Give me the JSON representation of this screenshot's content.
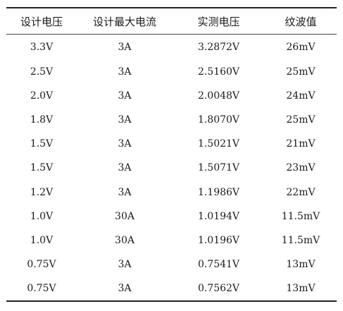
{
  "table": {
    "headers": [
      "设计电压",
      "设计最大电流",
      "实测电压",
      "纹波值"
    ],
    "rows": [
      [
        "3.3V",
        "3A",
        "3.2872V",
        "26mV"
      ],
      [
        "2.5V",
        "3A",
        "2.5160V",
        "25mV"
      ],
      [
        "2.0V",
        "3A",
        "2.0048V",
        "24mV"
      ],
      [
        "1.8V",
        "3A",
        "1.8070V",
        "25mV"
      ],
      [
        "1.5V",
        "3A",
        "1.5021V",
        "21mV"
      ],
      [
        "1.5V",
        "3A",
        "1.5071V",
        "23mV"
      ],
      [
        "1.2V",
        "3A",
        "1.1986V",
        "22mV"
      ],
      [
        "1.0V",
        "30A",
        "1.0194V",
        "11.5mV"
      ],
      [
        "1.0V",
        "30A",
        "1.0196V",
        "11.5mV"
      ],
      [
        "0.75V",
        "3A",
        "0.7541V",
        "13mV"
      ],
      [
        "0.75V",
        "3A",
        "0.7562V",
        "13mV"
      ]
    ]
  }
}
